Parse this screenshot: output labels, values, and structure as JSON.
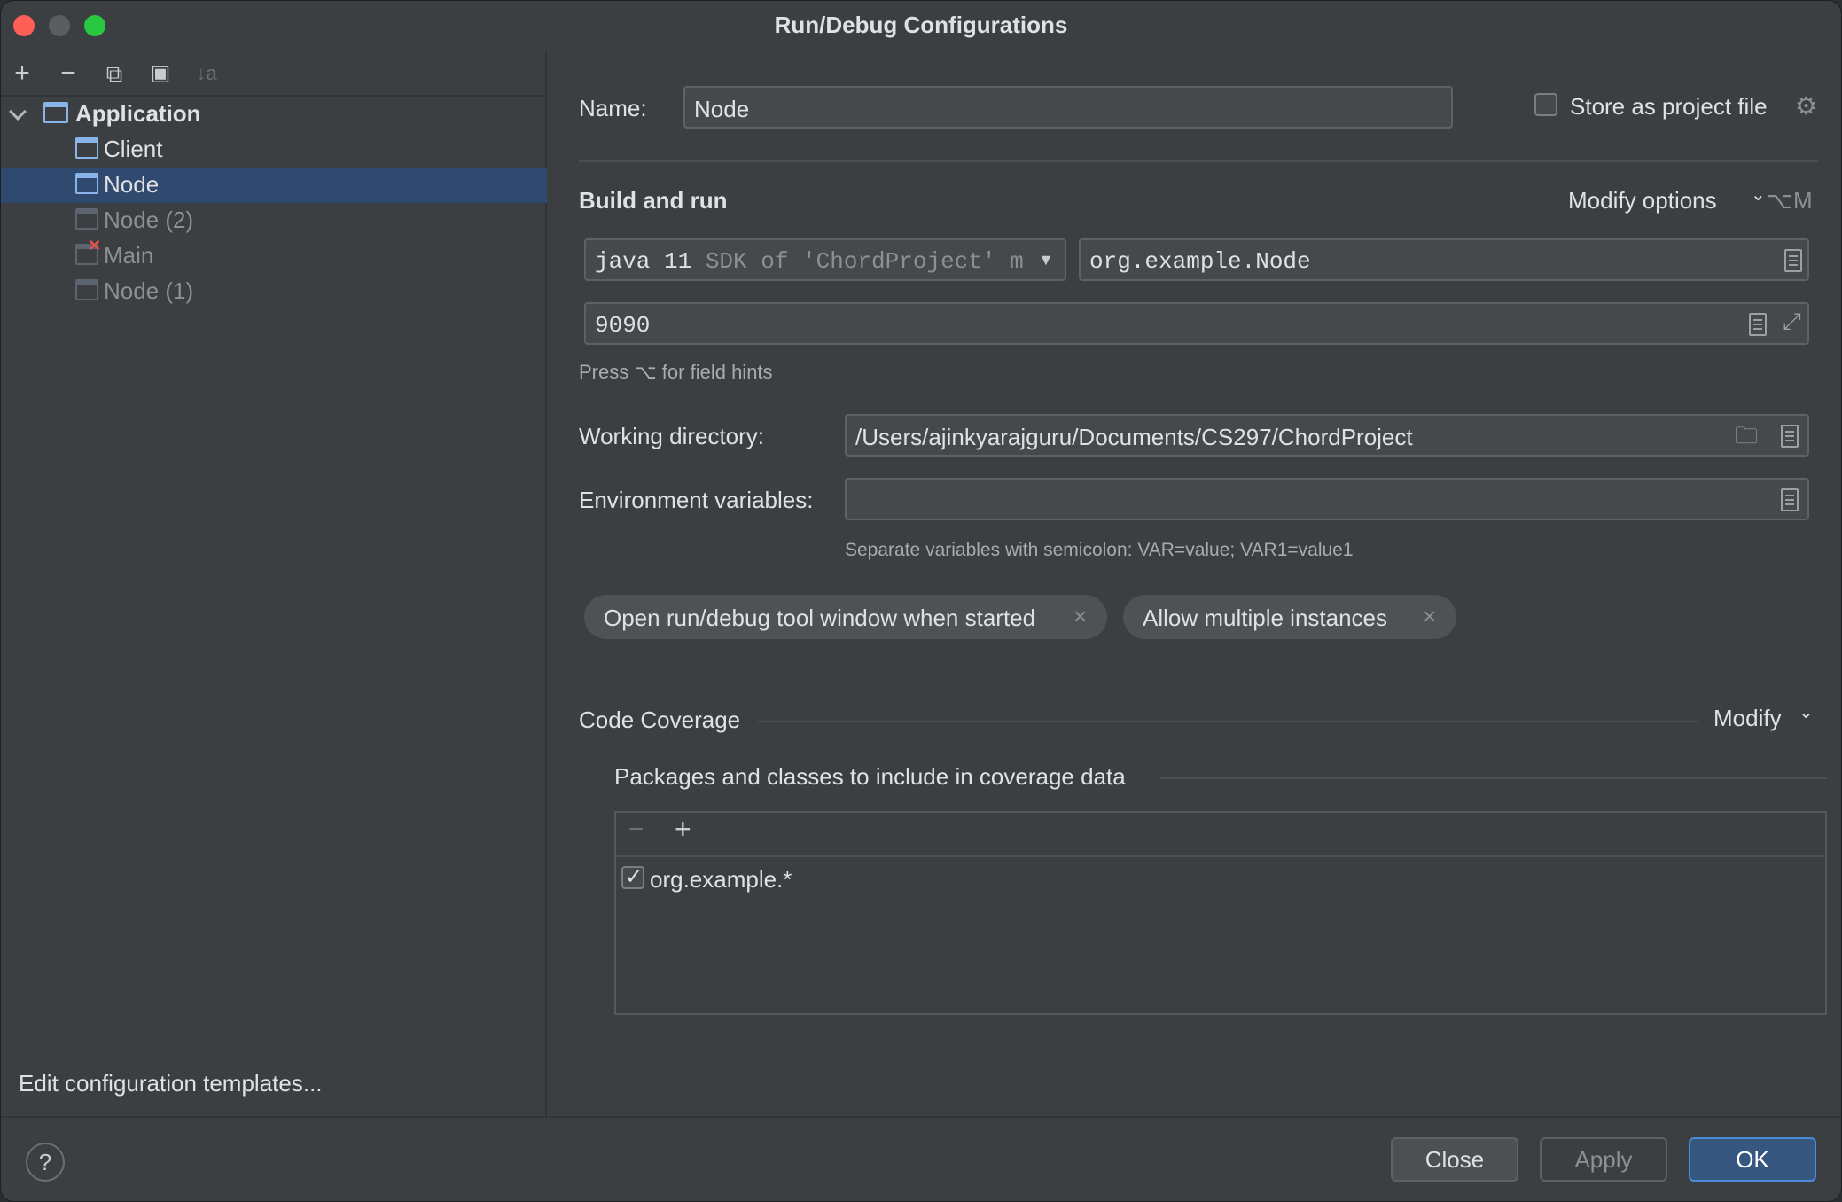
{
  "window": {
    "title": "Run/Debug Configurations"
  },
  "left": {
    "toolbar": {
      "add": "+",
      "remove": "−",
      "copy": "⧉",
      "folder": "▣",
      "sort": "↓a"
    },
    "tree": {
      "group": "Application",
      "items": [
        {
          "label": "Client",
          "dim": false,
          "selected": false,
          "error": false
        },
        {
          "label": "Node",
          "dim": false,
          "selected": true,
          "error": false
        },
        {
          "label": "Node (2)",
          "dim": true,
          "selected": false,
          "error": false
        },
        {
          "label": "Main",
          "dim": true,
          "selected": false,
          "error": true
        },
        {
          "label": "Node (1)",
          "dim": true,
          "selected": false,
          "error": false
        }
      ]
    },
    "edit_templates": "Edit configuration templates..."
  },
  "form": {
    "name_label": "Name:",
    "name_value": "Node",
    "store_as_project": "Store as project file",
    "build_run": "Build and run",
    "modify_options": "Modify options",
    "modify_shortcut": "⌥M",
    "sdk_main": "java 11",
    "sdk_hint": "SDK of 'ChordProject' m",
    "main_class": "org.example.Node",
    "program_args": "9090",
    "field_hint": "Press ⌥ for field hints",
    "workdir_label": "Working directory:",
    "workdir_value": "/Users/ajinkyarajguru/Documents/CS297/ChordProject",
    "env_label": "Environment variables:",
    "env_value": "",
    "env_hint": "Separate variables with semicolon: VAR=value; VAR1=value1",
    "chips": [
      "Open run/debug tool window when started",
      "Allow multiple instances"
    ],
    "coverage_title": "Code Coverage",
    "coverage_modify": "Modify",
    "packages_title": "Packages and classes to include in coverage data",
    "packages": [
      {
        "name": "org.example.*",
        "checked": true
      }
    ]
  },
  "buttons": {
    "close": "Close",
    "apply": "Apply",
    "ok": "OK",
    "help": "?"
  },
  "colors": {
    "accent": "#589df6",
    "selection": "#2f4a6e",
    "primary_button": "#365880"
  }
}
